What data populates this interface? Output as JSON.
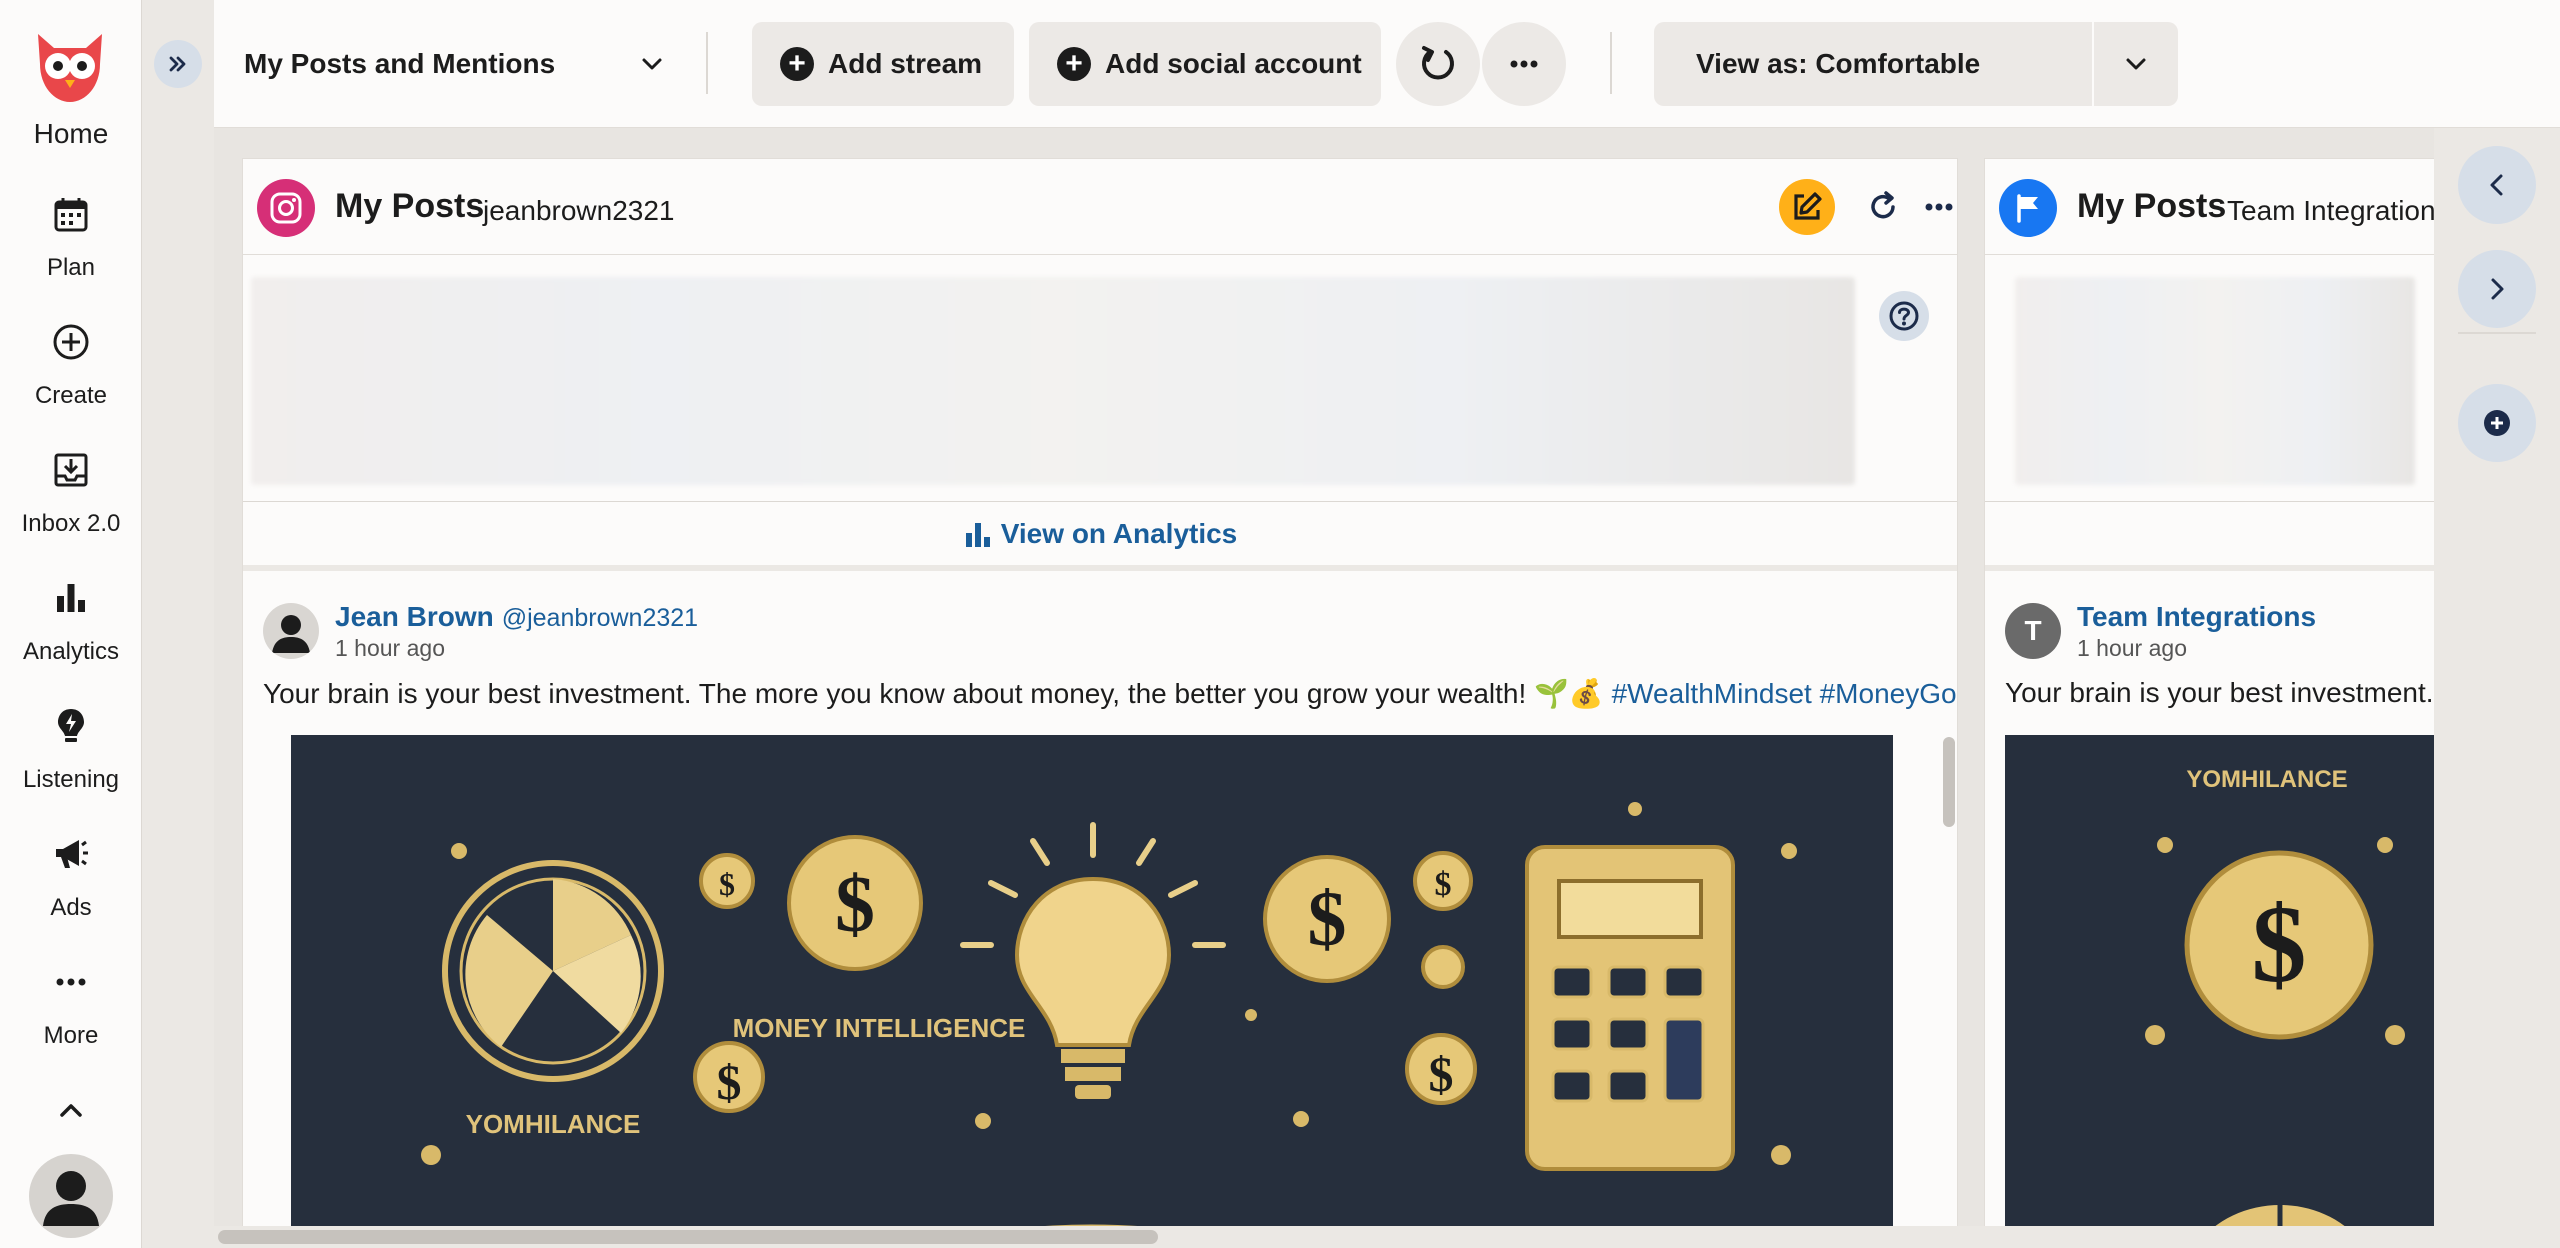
{
  "nav": {
    "home_label": "Home",
    "items": [
      {
        "label": "Plan",
        "icon": "calendar-icon"
      },
      {
        "label": "Create",
        "icon": "plus-circle-icon"
      },
      {
        "label": "Inbox 2.0",
        "icon": "inbox-icon"
      },
      {
        "label": "Analytics",
        "icon": "bar-chart-icon"
      },
      {
        "label": "Listening",
        "icon": "lightbulb-icon"
      },
      {
        "label": "Ads",
        "icon": "megaphone-icon"
      },
      {
        "label": "More",
        "icon": "more-dots-icon"
      }
    ]
  },
  "toolbar": {
    "tab_name": "My Posts and Mentions",
    "add_stream": "Add stream",
    "add_social_account": "Add social account",
    "view_as": "View as: Comfortable"
  },
  "streams": [
    {
      "network": "instagram",
      "title": "My Posts",
      "subtitle": "jeanbrown2321",
      "view_analytics": "View on Analytics",
      "post": {
        "author": "Jean Brown",
        "handle": "@jeanbrown2321",
        "time": "1 hour ago",
        "text": "Your brain is your best investment. The more you know about money, the better you grow your wealth! 🌱💰",
        "hashtags": [
          "#WealthMindset",
          "#MoneyGoals"
        ],
        "image_caption": "MONEY INTELLIGENCE",
        "image_sub": "YOMHILANCE"
      }
    },
    {
      "network": "team",
      "title": "My Posts",
      "subtitle": "Team Integrations",
      "post": {
        "author": "Team Integrations",
        "avatar_letter": "T",
        "time": "1 hour ago",
        "text": "Your brain is your best investment. T",
        "image_caption": "YOMHILANCE"
      }
    }
  ],
  "colors": {
    "brand_red": "#e9474a",
    "link_blue": "#1a5e9a",
    "compose_yellow": "#ffb018",
    "instagram_pink": "#d62f77",
    "team_blue": "#1877f2"
  }
}
